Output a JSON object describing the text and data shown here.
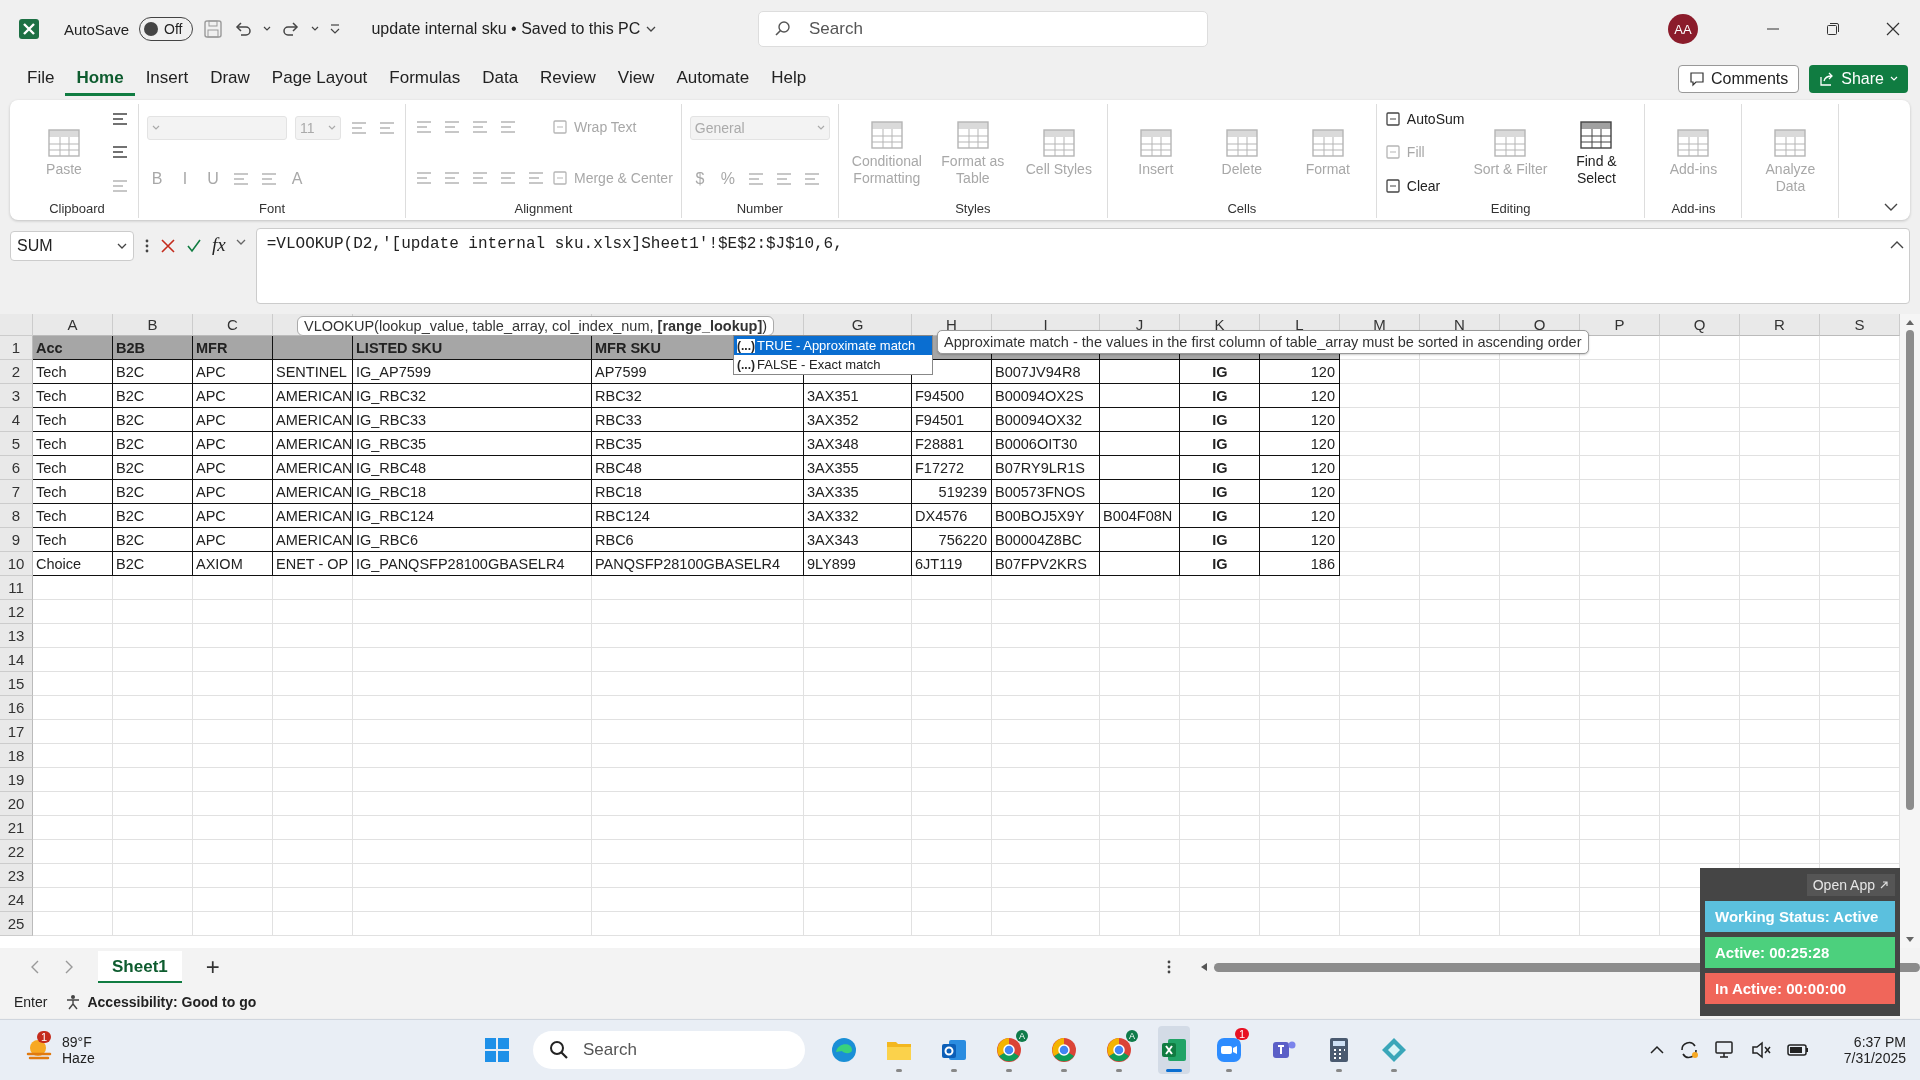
{
  "titlebar": {
    "autosave": {
      "label": "AutoSave",
      "on": false,
      "state": "Off"
    },
    "document": "update internal sku • Saved to this PC",
    "search": {
      "placeholder": "Search"
    },
    "avatar": "AA"
  },
  "ribbon": {
    "tabs": [
      {
        "label": "File",
        "selected": false
      },
      {
        "label": "Home",
        "selected": true
      },
      {
        "label": "Insert",
        "selected": false
      },
      {
        "label": "Draw",
        "selected": false
      },
      {
        "label": "Page Layout",
        "selected": false
      },
      {
        "label": "Formulas",
        "selected": false
      },
      {
        "label": "Data",
        "selected": false
      },
      {
        "label": "Review",
        "selected": false
      },
      {
        "label": "View",
        "selected": false
      },
      {
        "label": "Automate",
        "selected": false
      },
      {
        "label": "Help",
        "selected": false
      }
    ],
    "comments": "Comments",
    "share": "Share",
    "groups": [
      {
        "label": "Clipboard",
        "columns": [
          [
            [
              {
                "kind": "large",
                "label": "Paste",
                "disabled": true
              }
            ]
          ],
          [
            [
              {
                "kind": "icon",
                "disabled": false
              }
            ],
            [
              {
                "kind": "icon",
                "disabled": false
              }
            ],
            [
              {
                "kind": "icon",
                "disabled": true
              }
            ]
          ]
        ]
      },
      {
        "label": "Font",
        "columns": [
          [
            [
              {
                "kind": "field",
                "disabled": true
              },
              {
                "kind": "field",
                "value": "11",
                "disabled": true
              },
              {
                "kind": "icon",
                "disabled": true
              },
              {
                "kind": "icon",
                "disabled": true
              }
            ],
            [
              {
                "kind": "glyph",
                "label": "B",
                "disabled": true
              },
              {
                "kind": "glyph",
                "label": "I",
                "disabled": true
              },
              {
                "kind": "glyph",
                "label": "U",
                "disabled": true
              },
              {
                "kind": "icon",
                "disabled": true
              },
              {
                "kind": "icon",
                "disabled": true
              },
              {
                "kind": "glyph",
                "label": "A",
                "disabled": true
              }
            ]
          ]
        ]
      },
      {
        "label": "Alignment",
        "columns": [
          [
            [
              {
                "kind": "icon",
                "disabled": true
              },
              {
                "kind": "icon",
                "disabled": true
              },
              {
                "kind": "icon",
                "disabled": true
              },
              {
                "kind": "icon",
                "disabled": true
              }
            ],
            [
              {
                "kind": "icon",
                "disabled": true
              },
              {
                "kind": "icon",
                "disabled": true
              },
              {
                "kind": "icon",
                "disabled": true
              },
              {
                "kind": "icon",
                "disabled": true
              },
              {
                "kind": "icon",
                "disabled": true
              }
            ]
          ],
          [
            [
              {
                "kind": "small",
                "label": "Wrap Text",
                "disabled": true
              }
            ],
            [
              {
                "kind": "small",
                "label": "Merge & Center",
                "disabled": true
              }
            ]
          ]
        ]
      },
      {
        "label": "Number",
        "columns": [
          [
            [
              {
                "kind": "field",
                "value": "General",
                "disabled": true
              }
            ],
            [
              {
                "kind": "glyph",
                "label": "$",
                "disabled": true
              },
              {
                "kind": "glyph",
                "label": "%",
                "disabled": true
              },
              {
                "kind": "icon",
                "disabled": true
              },
              {
                "kind": "icon",
                "disabled": true
              },
              {
                "kind": "icon",
                "disabled": true
              }
            ]
          ]
        ]
      },
      {
        "label": "Styles",
        "columns": [
          [
            [
              {
                "kind": "large",
                "label": "Conditional Formatting",
                "disabled": true
              }
            ]
          ],
          [
            [
              {
                "kind": "large",
                "label": "Format as Table",
                "disabled": true
              }
            ]
          ],
          [
            [
              {
                "kind": "large",
                "label": "Cell Styles",
                "disabled": true
              }
            ]
          ]
        ]
      },
      {
        "label": "Cells",
        "columns": [
          [
            [
              {
                "kind": "large",
                "label": "Insert",
                "disabled": true
              }
            ]
          ],
          [
            [
              {
                "kind": "large",
                "label": "Delete",
                "disabled": true
              }
            ]
          ],
          [
            [
              {
                "kind": "large",
                "label": "Format",
                "disabled": true
              }
            ]
          ]
        ]
      },
      {
        "label": "Editing",
        "columns": [
          [
            [
              {
                "kind": "small",
                "label": "AutoSum",
                "disabled": false
              }
            ],
            [
              {
                "kind": "small",
                "label": "Fill",
                "disabled": true
              }
            ],
            [
              {
                "kind": "small",
                "label": "Clear",
                "disabled": false
              }
            ]
          ],
          [
            [
              {
                "kind": "large",
                "label": "Sort & Filter",
                "disabled": true
              }
            ]
          ],
          [
            [
              {
                "kind": "large",
                "label": "Find & Select",
                "disabled": false
              }
            ]
          ]
        ]
      },
      {
        "label": "Add-ins",
        "columns": [
          [
            [
              {
                "kind": "large",
                "label": "Add-ins",
                "disabled": true
              }
            ]
          ]
        ]
      },
      {
        "columns": [
          [
            [
              {
                "kind": "large",
                "label": "Analyze Data",
                "disabled": true
              }
            ]
          ]
        ]
      }
    ]
  },
  "formula_bar": {
    "name_box": "SUM",
    "fx": "fx",
    "formula": "=VLOOKUP(D2,'[update internal sku.xlsx]Sheet1'!$E$2:$J$10,6,"
  },
  "sheet": {
    "columns": [
      {
        "label": "A",
        "kind": "text"
      },
      {
        "label": "B",
        "kind": "text"
      },
      {
        "label": "C",
        "kind": "text"
      },
      {
        "kind": "text"
      },
      {
        "kind": "text"
      },
      {
        "kind": "text"
      },
      {
        "label": "G",
        "kind": "text"
      },
      {
        "label": "H",
        "kind": "text"
      },
      {
        "label": "I",
        "kind": "text"
      },
      {
        "label": "J",
        "kind": "text"
      },
      {
        "label": "K",
        "kind": "flag"
      },
      {
        "label": "L",
        "kind": "number"
      },
      {
        "label": "M",
        "kind": "text"
      },
      {
        "label": "N",
        "kind": "text"
      },
      {
        "label": "O",
        "kind": "text"
      },
      {
        "label": "P",
        "kind": "text"
      },
      {
        "label": "Q",
        "kind": "text"
      },
      {
        "label": "R",
        "kind": "text"
      },
      {
        "label": "S",
        "kind": "text"
      }
    ],
    "header_row": {
      "number": "1",
      "cells": [
        "Acc",
        "B2B",
        "MFR",
        null,
        "LISTED SKU",
        "MFR SKU"
      ]
    },
    "rows": [
      {
        "number": "2",
        "cells": [
          "Tech",
          "B2C",
          "APC",
          "SENTINEL",
          "IG_AP7599",
          "AP7599",
          null,
          null,
          "B007JV94R8",
          null,
          "IG",
          "120"
        ]
      },
      {
        "number": "3",
        "cells": [
          "Tech",
          "B2C",
          "APC",
          "AMERICAN",
          "IG_RBC32",
          "RBC32",
          "3AX351",
          "F94500",
          "B00094OX2S",
          null,
          "IG",
          "120"
        ]
      },
      {
        "number": "4",
        "cells": [
          "Tech",
          "B2C",
          "APC",
          "AMERICAN",
          "IG_RBC33",
          "RBC33",
          "3AX352",
          "F94501",
          "B00094OX32",
          null,
          "IG",
          "120"
        ]
      },
      {
        "number": "5",
        "cells": [
          "Tech",
          "B2C",
          "APC",
          "AMERICAN",
          "IG_RBC35",
          "RBC35",
          "3AX348",
          "F28881",
          "B0006OIT30",
          null,
          "IG",
          "120"
        ]
      },
      {
        "number": "6",
        "cells": [
          "Tech",
          "B2C",
          "APC",
          "AMERICAN",
          "IG_RBC48",
          "RBC48",
          "3AX355",
          "F17272",
          "B07RY9LR1S",
          null,
          "IG",
          "120"
        ]
      },
      {
        "number": "7",
        "cells": [
          "Tech",
          "B2C",
          "APC",
          "AMERICAN",
          "IG_RBC18",
          "RBC18",
          "3AX335",
          {
            "text": "519239",
            "kind": "number"
          },
          "B00573FNOS",
          null,
          "IG",
          "120"
        ]
      },
      {
        "number": "8",
        "cells": [
          "Tech",
          "B2C",
          "APC",
          "AMERICAN",
          "IG_RBC124",
          "RBC124",
          "3AX332",
          "DX4576",
          "B00BOJ5X9Y",
          "B004F08N",
          "IG",
          "120"
        ]
      },
      {
        "number": "9",
        "cells": [
          "Tech",
          "B2C",
          "APC",
          "AMERICAN",
          "IG_RBC6",
          "RBC6",
          "3AX343",
          {
            "text": "756220",
            "kind": "number"
          },
          "B00004Z8BC",
          null,
          "IG",
          "120"
        ]
      },
      {
        "number": "10",
        "cells": [
          "Choice",
          "B2C",
          "AXIOM",
          "ENET - OP",
          "IG_PANQSFP28100GBASELR4",
          "PANQSFP28100GBASELR4",
          "9LY899",
          "6JT119",
          "B07FPV2KRS",
          null,
          "IG",
          "186"
        ]
      },
      {
        "number": "11"
      },
      {
        "number": "12"
      },
      {
        "number": "13"
      },
      {
        "number": "14"
      },
      {
        "number": "15"
      },
      {
        "number": "16"
      },
      {
        "number": "17"
      },
      {
        "number": "18"
      },
      {
        "number": "19"
      },
      {
        "number": "20"
      },
      {
        "number": "21"
      },
      {
        "number": "22"
      },
      {
        "number": "23"
      },
      {
        "number": "24"
      },
      {
        "number": "25"
      }
    ]
  },
  "function_tip": "VLOOKUP(lookup_value, table_array, col_index_num, **[range_lookup]**)",
  "autocomplete": [
    {
      "marker": "(...)",
      "label": "TRUE - Approximate match",
      "selected": true
    },
    {
      "marker": "(...)",
      "label": "FALSE - Exact match",
      "selected": false
    }
  ],
  "description": "Approximate match - the values in the first column of table_array must be sorted in ascending order",
  "sheet_tabs": {
    "tabs": [
      {
        "label": "Sheet1",
        "selected": true
      }
    ],
    "add": "+"
  },
  "status_bar": {
    "mode": "Enter",
    "accessibility": "Accessibility: Good to go"
  },
  "tracker": {
    "open_app": "Open App",
    "bars": [
      {
        "label": "Working Status: Active",
        "color": "#5bc0de"
      },
      {
        "label": "Active: 00:25:28",
        "color": "#4cd07d"
      },
      {
        "label": "In Active: 00:00:00",
        "color": "#f0665a"
      }
    ]
  },
  "taskbar": {
    "weather": {
      "badge": "1",
      "temp": "89°F",
      "condition": "Haze"
    },
    "search": {
      "placeholder": "Search"
    },
    "apps": [
      {
        "running": false,
        "active": false
      },
      {
        "running": true,
        "active": false
      },
      {
        "running": true,
        "active": false
      },
      {
        "running": true,
        "active": false,
        "profile": "A"
      },
      {
        "running": true,
        "active": false
      },
      {
        "running": true,
        "active": false,
        "profile": "A"
      },
      {
        "running": true,
        "active": true
      },
      {
        "running": true,
        "active": false,
        "badge": "1"
      },
      {
        "running": false,
        "active": false
      },
      {
        "running": true,
        "active": false
      },
      {
        "running": true,
        "active": false
      }
    ],
    "clock": {
      "time": "6:37 PM",
      "date": "7/31/2025"
    }
  }
}
